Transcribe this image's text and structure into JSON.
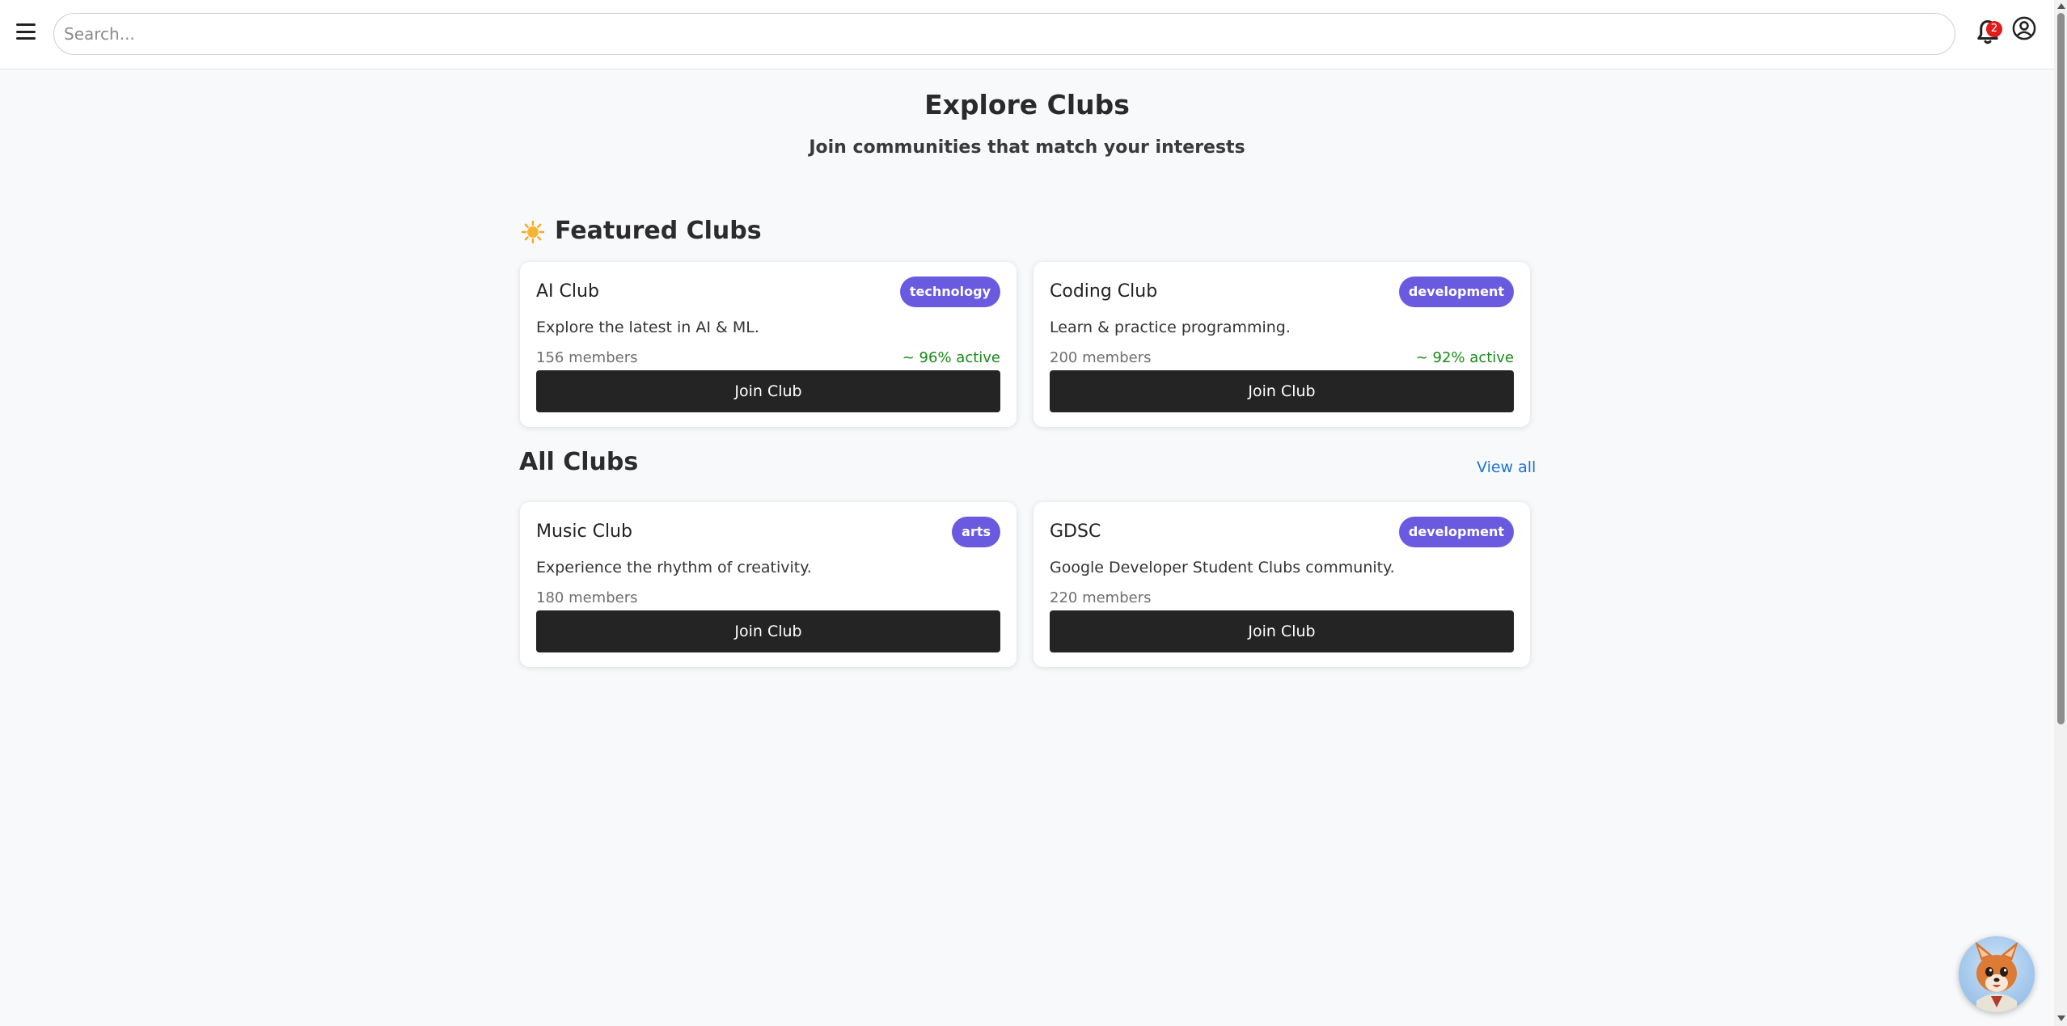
{
  "header": {
    "search_placeholder": "Search...",
    "notification_count": "2"
  },
  "page": {
    "title": "Explore Clubs",
    "subtitle": "Join communities that match your interests"
  },
  "featured": {
    "title": "Featured Clubs",
    "clubs": [
      {
        "name": "AI Club",
        "tag": "technology",
        "description": "Explore the latest in AI & ML.",
        "members": "156 members",
        "active": "~ 96% active",
        "button": "Join Club"
      },
      {
        "name": "Coding Club",
        "tag": "development",
        "description": "Learn & practice programming.",
        "members": "200 members",
        "active": "~ 92% active",
        "button": "Join Club"
      }
    ]
  },
  "all": {
    "title": "All Clubs",
    "view_all": "View all",
    "clubs": [
      {
        "name": "Music Club",
        "tag": "arts",
        "description": "Experience the rhythm of creativity.",
        "members": "180 members",
        "button": "Join Club"
      },
      {
        "name": "GDSC",
        "tag": "development",
        "description": "Google Developer Student Clubs community.",
        "members": "220 members",
        "button": "Join Club"
      }
    ]
  },
  "colors": {
    "tag": "#6a5ae0",
    "active": "#178a17",
    "button": "#242424",
    "link": "#1e73d6",
    "badge": "#e21b1b"
  }
}
